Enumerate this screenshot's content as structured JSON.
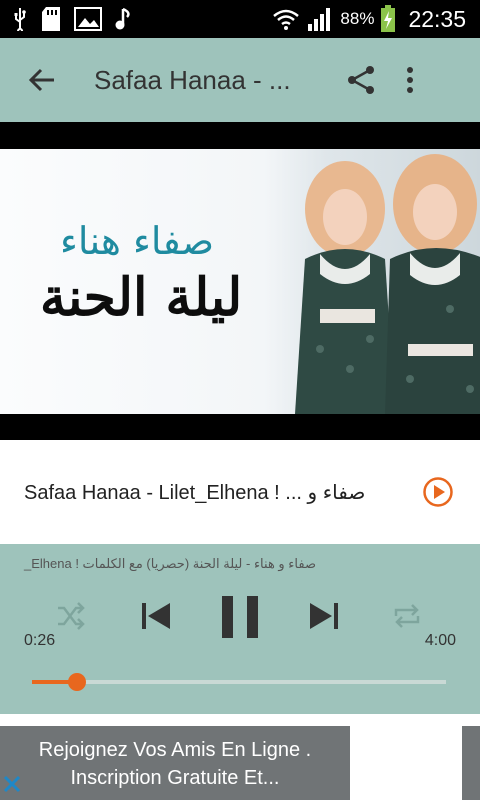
{
  "status_bar": {
    "icons": [
      "usb-icon",
      "sd-card-icon",
      "image-icon",
      "music-note-icon",
      "wifi-icon",
      "signal-icon",
      "battery-charging-icon"
    ],
    "battery_percent": "88%",
    "time": "22:35"
  },
  "app_bar": {
    "title": "Safaa Hanaa - ..."
  },
  "cover": {
    "artist_ar": "صفاء هناء",
    "title_ar": "ليلة الحنة"
  },
  "track": {
    "label": "Safaa Hanaa - Lilet_Elhena ! ... صفاء و"
  },
  "player": {
    "marquee": "صفاء و هناء - ليلة الحنة (حصريا) مع الكلمات ! Elhena_",
    "elapsed": "0:26",
    "total": "4:00",
    "progress_fraction": 0.108
  },
  "ad": {
    "line1": "Rejoignez Vos Amis En Ligne .",
    "line2": "Inscription Gratuite Et..."
  },
  "colors": {
    "accent": "#e8671e",
    "toolbar": "#9ec3bb"
  }
}
